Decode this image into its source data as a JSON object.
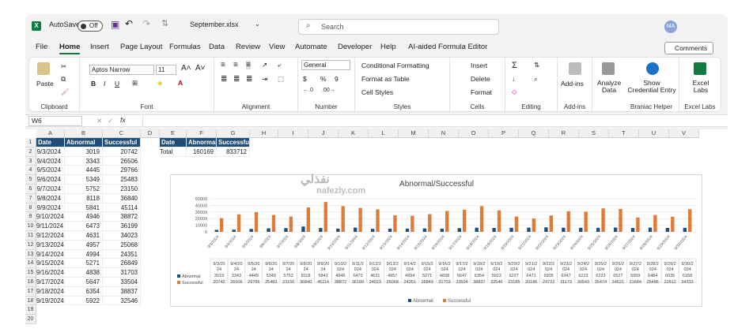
{
  "titlebar": {
    "autosave_label": "AutoSave",
    "autosave_state": "Off",
    "filename": "September.xlsx",
    "search_placeholder": "Search",
    "avatar_initials": "MA"
  },
  "menu": {
    "items": [
      "File",
      "Home",
      "Insert",
      "Page Layout",
      "Formulas",
      "Data",
      "Review",
      "View",
      "Automate",
      "Developer",
      "Help",
      "AI-aided Formula Editor"
    ],
    "active": "Home",
    "comments_label": "Comments"
  },
  "ribbon": {
    "clipboard": {
      "label": "Clipboard",
      "paste": "Paste"
    },
    "font": {
      "label": "Font",
      "name": "Aptos Narrow",
      "size": "11",
      "bold": "B",
      "italic": "I",
      "underline": "U"
    },
    "alignment": {
      "label": "Alignment"
    },
    "number": {
      "label": "Number",
      "format": "General",
      "dollar": "$",
      "percent": "%",
      "comma": "9"
    },
    "styles": {
      "label": "Styles",
      "cond": "Conditional Formatting",
      "table": "Format as Table",
      "cell": "Cell Styles"
    },
    "cells": {
      "label": "Cells",
      "insert": "Insert",
      "delete": "Delete",
      "format": "Format"
    },
    "editing": {
      "label": "Editing"
    },
    "addins": {
      "label": "Add-ins",
      "btn": "Add-ins"
    },
    "analyze": {
      "btn": "Analyze Data"
    },
    "braniac": {
      "label": "Braniac Helper",
      "btn": "Show Credential Entry"
    },
    "excellabs": {
      "label": "Excel Labs",
      "btn": "Excel Labs"
    }
  },
  "formula_bar": {
    "cell_ref": "W6",
    "fx": "fx"
  },
  "grid": {
    "columns": [
      "A",
      "B",
      "C",
      "D",
      "E",
      "F",
      "G",
      "H",
      "I",
      "J",
      "K",
      "L",
      "M",
      "N",
      "O",
      "P",
      "Q",
      "R",
      "S",
      "T",
      "U",
      "V"
    ],
    "rows": [
      "1",
      "2",
      "3",
      "4",
      "5",
      "6",
      "7",
      "8",
      "9",
      "10",
      "11",
      "12",
      "13",
      "14",
      "15",
      "16",
      "17",
      "18",
      "19",
      "20"
    ],
    "headers": [
      "Date",
      "Abnormal",
      "Successful"
    ],
    "data": [
      [
        "9/3/2024",
        "3019",
        "20742"
      ],
      [
        "9/4/2024",
        "3343",
        "26506"
      ],
      [
        "9/5/2024",
        "4445",
        "29766"
      ],
      [
        "9/6/2024",
        "5349",
        "25483"
      ],
      [
        "9/7/2024",
        "5752",
        "23150"
      ],
      [
        "9/8/2024",
        "8118",
        "36840"
      ],
      [
        "9/9/2024",
        "5841",
        "45114"
      ],
      [
        "9/10/2024",
        "4946",
        "38872"
      ],
      [
        "9/11/2024",
        "6473",
        "36199"
      ],
      [
        "9/12/2024",
        "4631",
        "34023"
      ],
      [
        "9/13/2024",
        "4957",
        "25068"
      ],
      [
        "9/14/2024",
        "4994",
        "24351"
      ],
      [
        "9/15/2024",
        "5271",
        "26849"
      ],
      [
        "9/16/2024",
        "4838",
        "31703"
      ],
      [
        "9/17/2024",
        "5647",
        "33504"
      ],
      [
        "9/18/2024",
        "6354",
        "38837"
      ],
      [
        "9/19/2024",
        "5922",
        "32546"
      ]
    ],
    "summary_headers": [
      "Date",
      "Abnormal",
      "Successful"
    ],
    "summary_row": [
      "Total",
      "160169",
      "833712"
    ]
  },
  "chart_data": {
    "type": "bar",
    "title": "Abnormal/Successful",
    "categories": [
      "9/3/2024",
      "9/4/2024",
      "9/5/2024",
      "9/6/2024",
      "9/7/2024",
      "9/8/2024",
      "9/9/2024",
      "9/10/2024",
      "9/11/2024",
      "9/12/2024",
      "9/13/2024",
      "9/14/2024",
      "9/15/2024",
      "9/16/2024",
      "9/17/2024",
      "9/18/2024",
      "9/19/2024",
      "9/20/2024",
      "9/21/2024",
      "9/22/2024",
      "9/23/2024",
      "9/24/2024",
      "9/25/2024",
      "9/26/2024",
      "9/27/2024",
      "9/28/2024",
      "9/29/2024",
      "9/30/2024"
    ],
    "table_labels": [
      "9/3/20 24",
      "9/4/20 24",
      "9/5/20 24",
      "9/6/20 24",
      "9/7/20 24",
      "9/8/20 24",
      "9/9/20 24",
      "9/10/2 024",
      "9/11/2 024",
      "9/12/2 024",
      "9/13/2 024",
      "9/14/2 024",
      "9/15/2 024",
      "9/16/2 024",
      "9/17/2 024",
      "9/18/2 024",
      "9/19/2 024",
      "9/20/2 024",
      "9/21/2 024",
      "9/22/2 024",
      "9/23/2 024",
      "9/24/2 024",
      "9/25/2 024",
      "9/26/2 024",
      "9/27/2 024",
      "9/28/2 024",
      "9/29/2 024",
      "9/30/2 024"
    ],
    "series": [
      {
        "name": "Abnormal",
        "color": "#1f4e79",
        "values": [
          3019,
          3343,
          4445,
          5349,
          5752,
          8118,
          5841,
          4946,
          6473,
          4631,
          4957,
          4994,
          5271,
          4838,
          5647,
          6354,
          5922,
          6227,
          6471,
          6905,
          6347,
          6223,
          6223,
          6527,
          5959,
          6484,
          6035,
          6158
        ]
      },
      {
        "name": "Successful",
        "color": "#e07b39",
        "values": [
          20742,
          26506,
          29766,
          25483,
          23150,
          36840,
          45114,
          38872,
          36199,
          34023,
          25068,
          24351,
          26849,
          31703,
          33504,
          38837,
          32546,
          23185,
          20186,
          24722,
          31173,
          30543,
          35474,
          34621,
          21684,
          25486,
          22812,
          34333
        ]
      }
    ],
    "y_ticks": [
      "50000",
      "40000",
      "30000",
      "20000",
      "10000",
      "0"
    ],
    "ylim": [
      0,
      50000
    ],
    "legend": "bottom",
    "grid": true
  },
  "watermark": {
    "arabic": "نفذلي",
    "url": "nafezly.com"
  }
}
